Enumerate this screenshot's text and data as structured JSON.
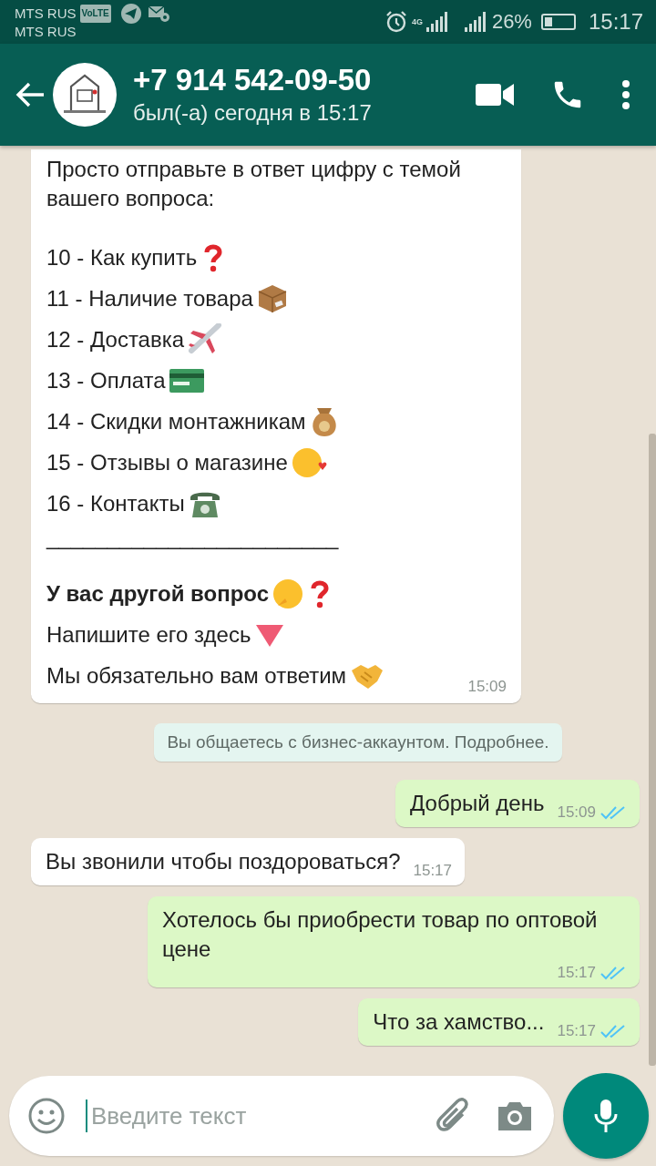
{
  "status_bar": {
    "carriers": [
      "MTS RUS",
      "MTS RUS"
    ],
    "volte": "VoLTE",
    "network": "4G",
    "battery": "26%",
    "time": "15:17"
  },
  "header": {
    "title": "+7 914 542-09-50",
    "subtitle": "был(-а) сегодня в 15:17"
  },
  "messages": [
    {
      "kind": "menu",
      "intro": "Просто отправьте в ответ цифру с темой вашего вопроса:",
      "items": [
        {
          "text": "10 - Как купить"
        },
        {
          "text": "11 - Наличие товара"
        },
        {
          "text": "12 - Доставка"
        },
        {
          "text": "13 - Оплата"
        },
        {
          "text": "14 - Скидки монтажникам"
        },
        {
          "text": "15 - Отзывы о магазине"
        },
        {
          "text": "16 - Контакты"
        }
      ],
      "separator": "________________________",
      "footer": [
        {
          "text": "У вас другой вопрос",
          "bold": true
        },
        {
          "text": "Напишите его здесь",
          "bold": false
        },
        {
          "text": "Мы обязательно вам ответим",
          "bold": false
        }
      ],
      "time": "15:09"
    },
    {
      "kind": "system",
      "text": "Вы общаетесь с бизнес-аккаунтом. Подробнее."
    },
    {
      "kind": "outgoing",
      "text": "Добрый день",
      "time": "15:09",
      "read": true
    },
    {
      "kind": "incoming",
      "text": "Вы звонили чтобы поздороваться?",
      "time": "15:17"
    },
    {
      "kind": "outgoing",
      "text": "Хотелось бы приобрести товар по оптовой цене",
      "time": "15:17",
      "read": true
    },
    {
      "kind": "outgoing",
      "text": "Что за хамство...",
      "time": "15:17",
      "read": true
    }
  ],
  "composer": {
    "placeholder": "Введите текст"
  }
}
